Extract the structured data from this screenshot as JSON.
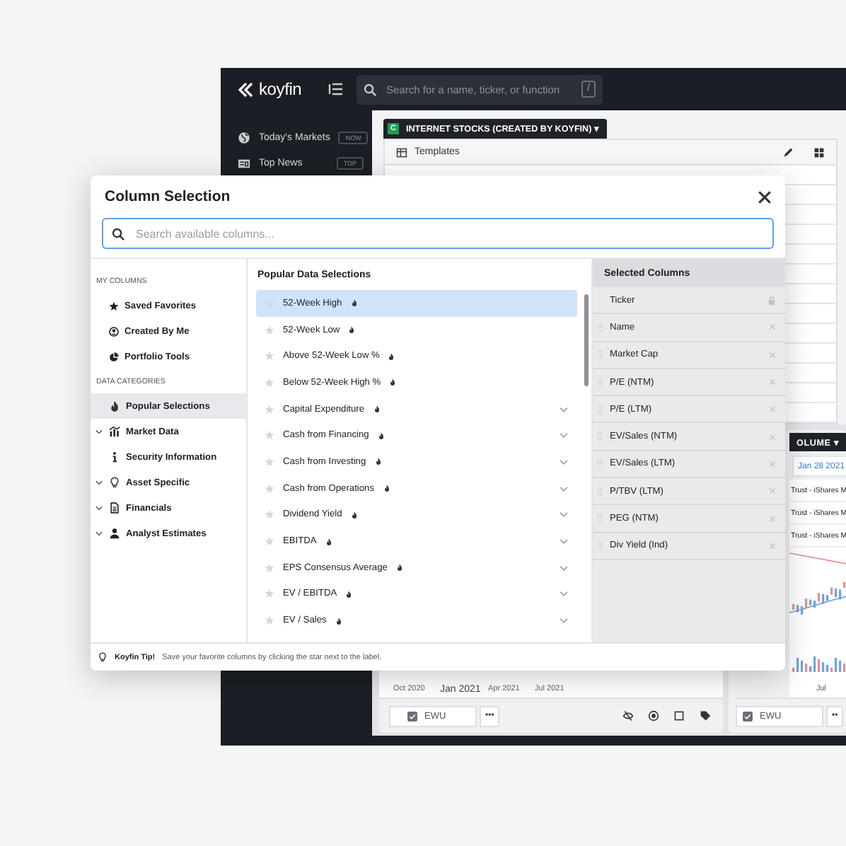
{
  "app": {
    "logo": "koyfin",
    "search": {
      "placeholder": "Search for a name, ticker, or function",
      "shortcut": "/"
    },
    "nav": [
      {
        "label": "Today's Markets",
        "badge": "NOW"
      },
      {
        "label": "Top News",
        "badge": "TOP"
      }
    ],
    "watchlist_tab": {
      "badge": "C",
      "label": "INTERNET STOCKS (CREATED BY KOYFIN) ▾"
    },
    "toolbar": {
      "label": "Templates"
    },
    "chart_panel": {
      "x_labels": [
        {
          "label": "Oct 2020",
          "major": false
        },
        {
          "label": "Jan 2021",
          "major": true
        },
        {
          "label": "Apr 2021",
          "major": false
        },
        {
          "label": "Jul 2021",
          "major": false
        }
      ],
      "ticker": {
        "value": "EWU",
        "checked": true
      },
      "more": "•••"
    },
    "side_panel": {
      "tab": "OLUME ▾",
      "date_tab": "Jan 28 2021",
      "rows": [
        "Trust - iShares M",
        "Trust - iShares M",
        "Trust - iShares M"
      ],
      "x_label": "Jul",
      "ticker": {
        "value": "EWU",
        "checked": true
      },
      "more": "••"
    }
  },
  "dialog": {
    "title": "Column Selection",
    "search": {
      "placeholder": "Search available columns..."
    },
    "my_columns": {
      "heading": "MY COLUMNS",
      "items": [
        {
          "label": "Saved Favorites",
          "selected": false
        },
        {
          "label": "Created By Me",
          "selected": false
        },
        {
          "label": "Portfolio Tools",
          "selected": false
        }
      ]
    },
    "data_categories": {
      "heading": "DATA CATEGORIES",
      "items": [
        {
          "label": "Popular Selections",
          "selected": true,
          "expandable": false
        },
        {
          "label": "Market Data",
          "selected": false,
          "expandable": true
        },
        {
          "label": "Security Information",
          "selected": false,
          "expandable": false
        },
        {
          "label": "Asset Specific",
          "selected": false,
          "expandable": true
        },
        {
          "label": "Financials",
          "selected": false,
          "expandable": true
        },
        {
          "label": "Analyst Estimates",
          "selected": false,
          "expandable": true
        }
      ]
    },
    "popular": {
      "heading": "Popular Data Selections",
      "items": [
        {
          "label": "52-Week High",
          "selected": true,
          "favorite": false,
          "expandable": false
        },
        {
          "label": "52-Week Low",
          "selected": false,
          "favorite": false,
          "expandable": false
        },
        {
          "label": "Above 52-Week Low %",
          "selected": false,
          "favorite": false,
          "expandable": false
        },
        {
          "label": "Below 52-Week High %",
          "selected": false,
          "favorite": false,
          "expandable": false
        },
        {
          "label": "Capital Expenditure",
          "selected": false,
          "favorite": false,
          "expandable": true
        },
        {
          "label": "Cash from Financing",
          "selected": false,
          "favorite": false,
          "expandable": true
        },
        {
          "label": "Cash from Investing",
          "selected": false,
          "favorite": false,
          "expandable": true
        },
        {
          "label": "Cash from Operations",
          "selected": false,
          "favorite": false,
          "expandable": true
        },
        {
          "label": "Dividend Yield",
          "selected": false,
          "favorite": false,
          "expandable": true
        },
        {
          "label": "EBITDA",
          "selected": false,
          "favorite": false,
          "expandable": true
        },
        {
          "label": "EPS Consensus Average",
          "selected": false,
          "favorite": false,
          "expandable": true
        },
        {
          "label": "EV / EBITDA",
          "selected": false,
          "favorite": false,
          "expandable": true
        },
        {
          "label": "EV / Sales",
          "selected": false,
          "favorite": false,
          "expandable": true
        }
      ]
    },
    "selected_columns": {
      "heading": "Selected Columns",
      "items": [
        {
          "label": "Ticker",
          "locked": true
        },
        {
          "label": "Name",
          "locked": false
        },
        {
          "label": "Market Cap",
          "locked": false
        },
        {
          "label": "P/E (NTM)",
          "locked": false
        },
        {
          "label": "P/E (LTM)",
          "locked": false
        },
        {
          "label": "EV/Sales (NTM)",
          "locked": false
        },
        {
          "label": "EV/Sales (LTM)",
          "locked": false
        },
        {
          "label": "P/TBV (LTM)",
          "locked": false
        },
        {
          "label": "PEG (NTM)",
          "locked": false
        },
        {
          "label": "Div Yield (Ind)",
          "locked": false
        }
      ]
    },
    "tip": {
      "label": "Koyfin Tip!",
      "text": "Save your favorite columns by clicking the star next to the label."
    }
  }
}
